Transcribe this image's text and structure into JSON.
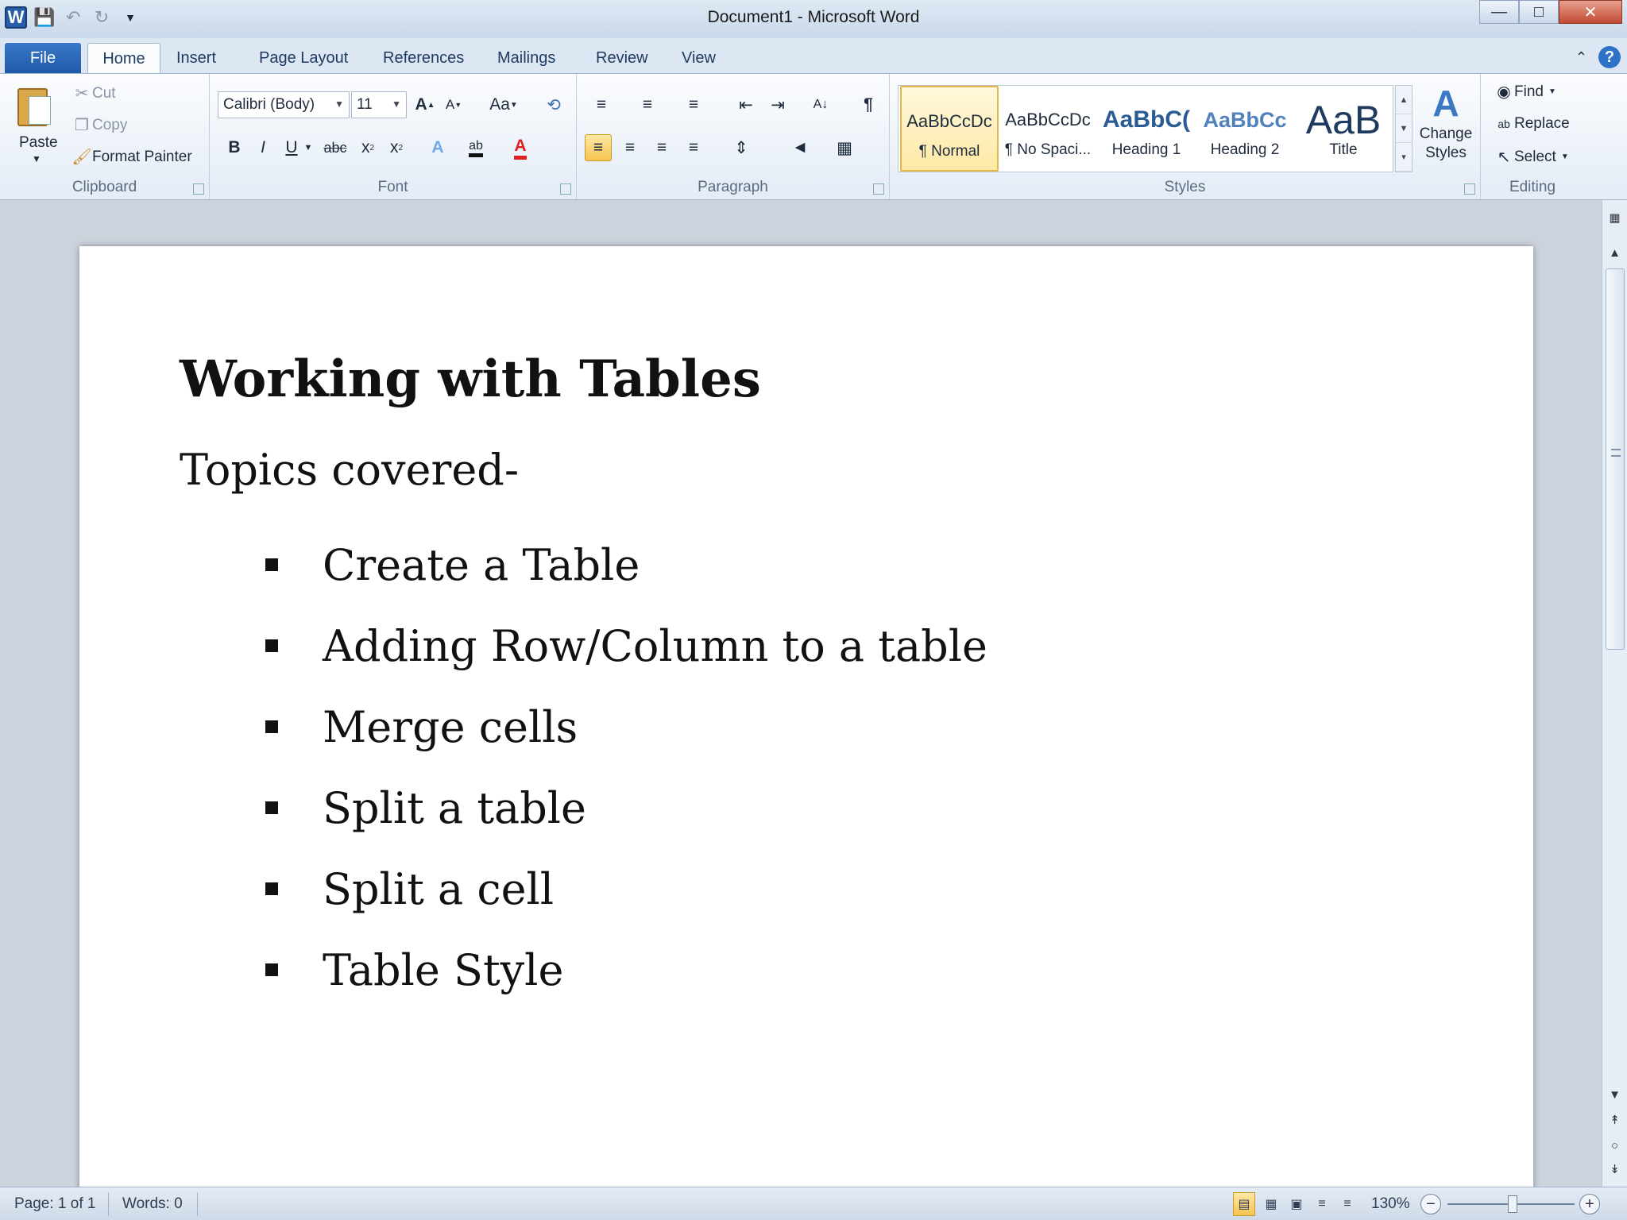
{
  "window": {
    "title": "Document1 - Microsoft Word"
  },
  "tabs": [
    {
      "label": "File"
    },
    {
      "label": "Home"
    },
    {
      "label": "Insert"
    },
    {
      "label": "Page Layout"
    },
    {
      "label": "References"
    },
    {
      "label": "Mailings"
    },
    {
      "label": "Review"
    },
    {
      "label": "View"
    }
  ],
  "clipboard": {
    "group_label": "Clipboard",
    "paste": "Paste",
    "cut": "Cut",
    "copy": "Copy",
    "format_painter": "Format Painter"
  },
  "font": {
    "group_label": "Font",
    "name": "Calibri (Body)",
    "size": "11"
  },
  "paragraph": {
    "group_label": "Paragraph"
  },
  "styles": {
    "group_label": "Styles",
    "items": [
      {
        "preview": "AaBbCcDc",
        "name": "¶ Normal"
      },
      {
        "preview": "AaBbCcDc",
        "name": "¶ No Spaci..."
      },
      {
        "preview": "AaBbC(",
        "name": "Heading 1"
      },
      {
        "preview": "AaBbCc",
        "name": "Heading 2"
      },
      {
        "preview": "AaB",
        "name": "Title"
      }
    ],
    "change_styles_1": "Change",
    "change_styles_2": "Styles"
  },
  "editing": {
    "group_label": "Editing",
    "find": "Find",
    "replace": "Replace",
    "select": "Select"
  },
  "document": {
    "title": "Working with Tables",
    "subtitle": "Topics covered-",
    "topics": [
      "Create a Table",
      "Adding Row/Column to a table",
      "Merge cells",
      "Split a table",
      "Split a cell",
      "Table Style"
    ]
  },
  "status": {
    "page": "Page: 1 of 1",
    "words": "Words: 0",
    "zoom": "130%"
  },
  "colors": {
    "accent": "#2a5da8",
    "highlight": "#f6c34f",
    "font_color": "#e02020"
  }
}
